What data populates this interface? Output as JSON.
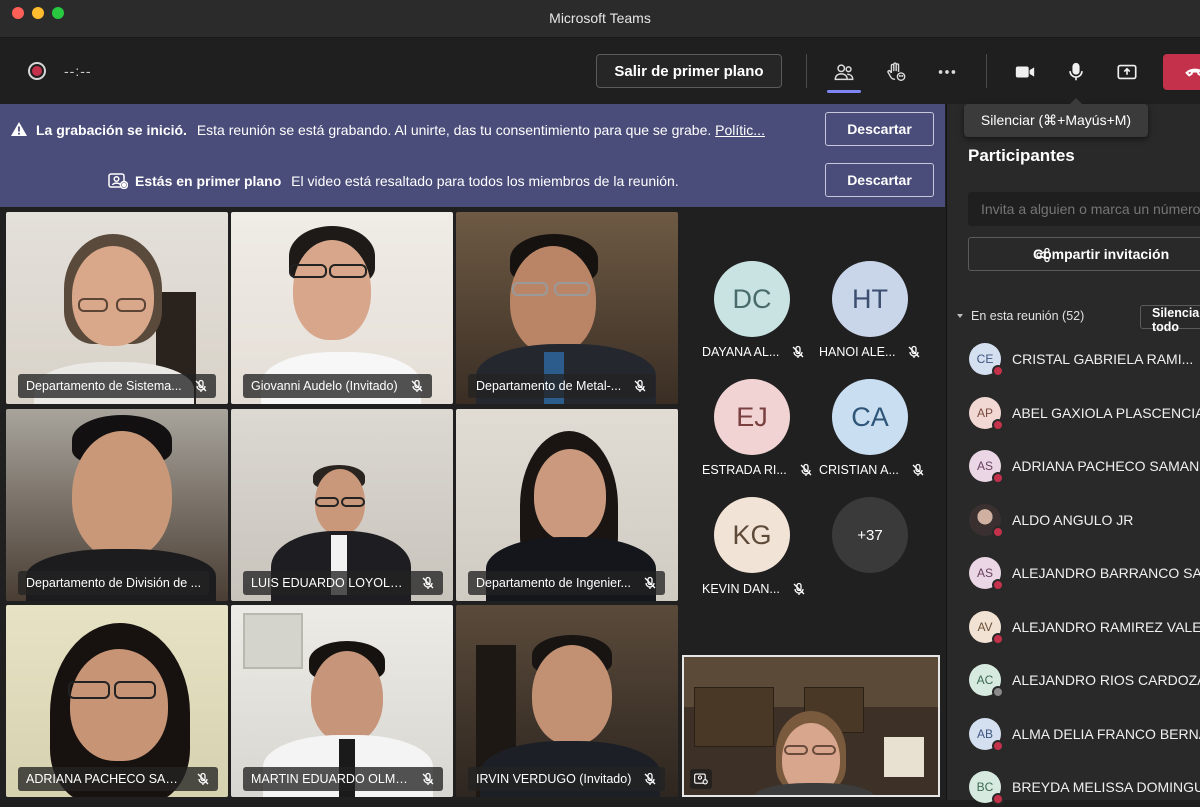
{
  "window": {
    "title": "Microsoft Teams"
  },
  "toolbar": {
    "timer": "--:--",
    "spotlight_exit_label": "Salir de primer plano",
    "icons": [
      "participants-icon",
      "reactions-icon",
      "more-icon",
      "camera-icon",
      "microphone-icon",
      "share-screen-icon",
      "leave-call-icon"
    ],
    "leave_color": "#c4314b",
    "accent": "#7f85f5"
  },
  "tooltip": {
    "text": "Silenciar (⌘+Mayús+M)"
  },
  "banners": {
    "recording": {
      "title": "La grabación se inició.",
      "message": "Esta reunión se está grabando. Al unirte, das tu consentimiento para que se grabe.",
      "link": "Polític...",
      "dismiss": "Descartar"
    },
    "spotlight": {
      "title": "Estás en primer plano",
      "message": "El video está resaltado para todos los miembros de la reunión.",
      "dismiss": "Descartar"
    }
  },
  "video_tiles": [
    {
      "name": "Departamento de Sistema..."
    },
    {
      "name": "Giovanni Audelo (Invitado)"
    },
    {
      "name": "Departamento de Metal-..."
    },
    {
      "name": "Departamento de División de ..."
    },
    {
      "name": "LUIS EDUARDO LOYOLA S..."
    },
    {
      "name": "Departamento de Ingenier..."
    },
    {
      "name": "ADRIANA PACHECO SAM..."
    },
    {
      "name": "MARTIN EDUARDO OLMO..."
    },
    {
      "name": "IRVIN VERDUGO (Invitado)"
    }
  ],
  "avatar_tiles": [
    {
      "initials": "DC",
      "name": "DAYANA AL...",
      "color": "#c9e3e3"
    },
    {
      "initials": "HT",
      "name": "HANOI ALE...",
      "color": "#c9d6ea"
    },
    {
      "initials": "EJ",
      "name": "ESTRADA RI...",
      "color": "#f1d3d3"
    },
    {
      "initials": "CA",
      "name": "CRISTIAN A...",
      "color": "#c9dff1"
    },
    {
      "initials": "KG",
      "name": "KEVIN DAN...",
      "color": "#f1e3d6"
    }
  ],
  "overflow": {
    "label": "+37"
  },
  "panel": {
    "title": "Participantes",
    "invite_placeholder": "Invita a alguien o marca un número",
    "share_invite_label": "Compartir invitación",
    "section_label": "En esta reunión (52)",
    "mute_all_label": "Silenciar todo",
    "participants": [
      {
        "initials": "CE",
        "name": "CRISTAL GABRIELA RAMI...",
        "color": "#d4dff0"
      },
      {
        "initials": "AP",
        "name": "ABEL GAXIOLA PLASCENCIA",
        "color": "#f2d8d3"
      },
      {
        "initials": "AS",
        "name": "ADRIANA PACHECO SAMANIEGO",
        "color": "#ead6e4"
      },
      {
        "initials": "",
        "name": "ALDO ANGULO JR",
        "color": "#555555"
      },
      {
        "initials": "AS",
        "name": "ALEJANDRO BARRANCO SAINZ",
        "color": "#ead6e4"
      },
      {
        "initials": "AV",
        "name": "ALEJANDRO RAMIREZ VALENZUELA",
        "color": "#f2e2d3"
      },
      {
        "initials": "AC",
        "name": "ALEJANDRO RIOS CARDOZA",
        "color": "#d6eadf"
      },
      {
        "initials": "AB",
        "name": "ALMA DELIA FRANCO BERNAL",
        "color": "#d4dff0"
      },
      {
        "initials": "BC",
        "name": "BREYDA MELISSA DOMINGUEZ",
        "color": "#d6eadf"
      }
    ]
  }
}
